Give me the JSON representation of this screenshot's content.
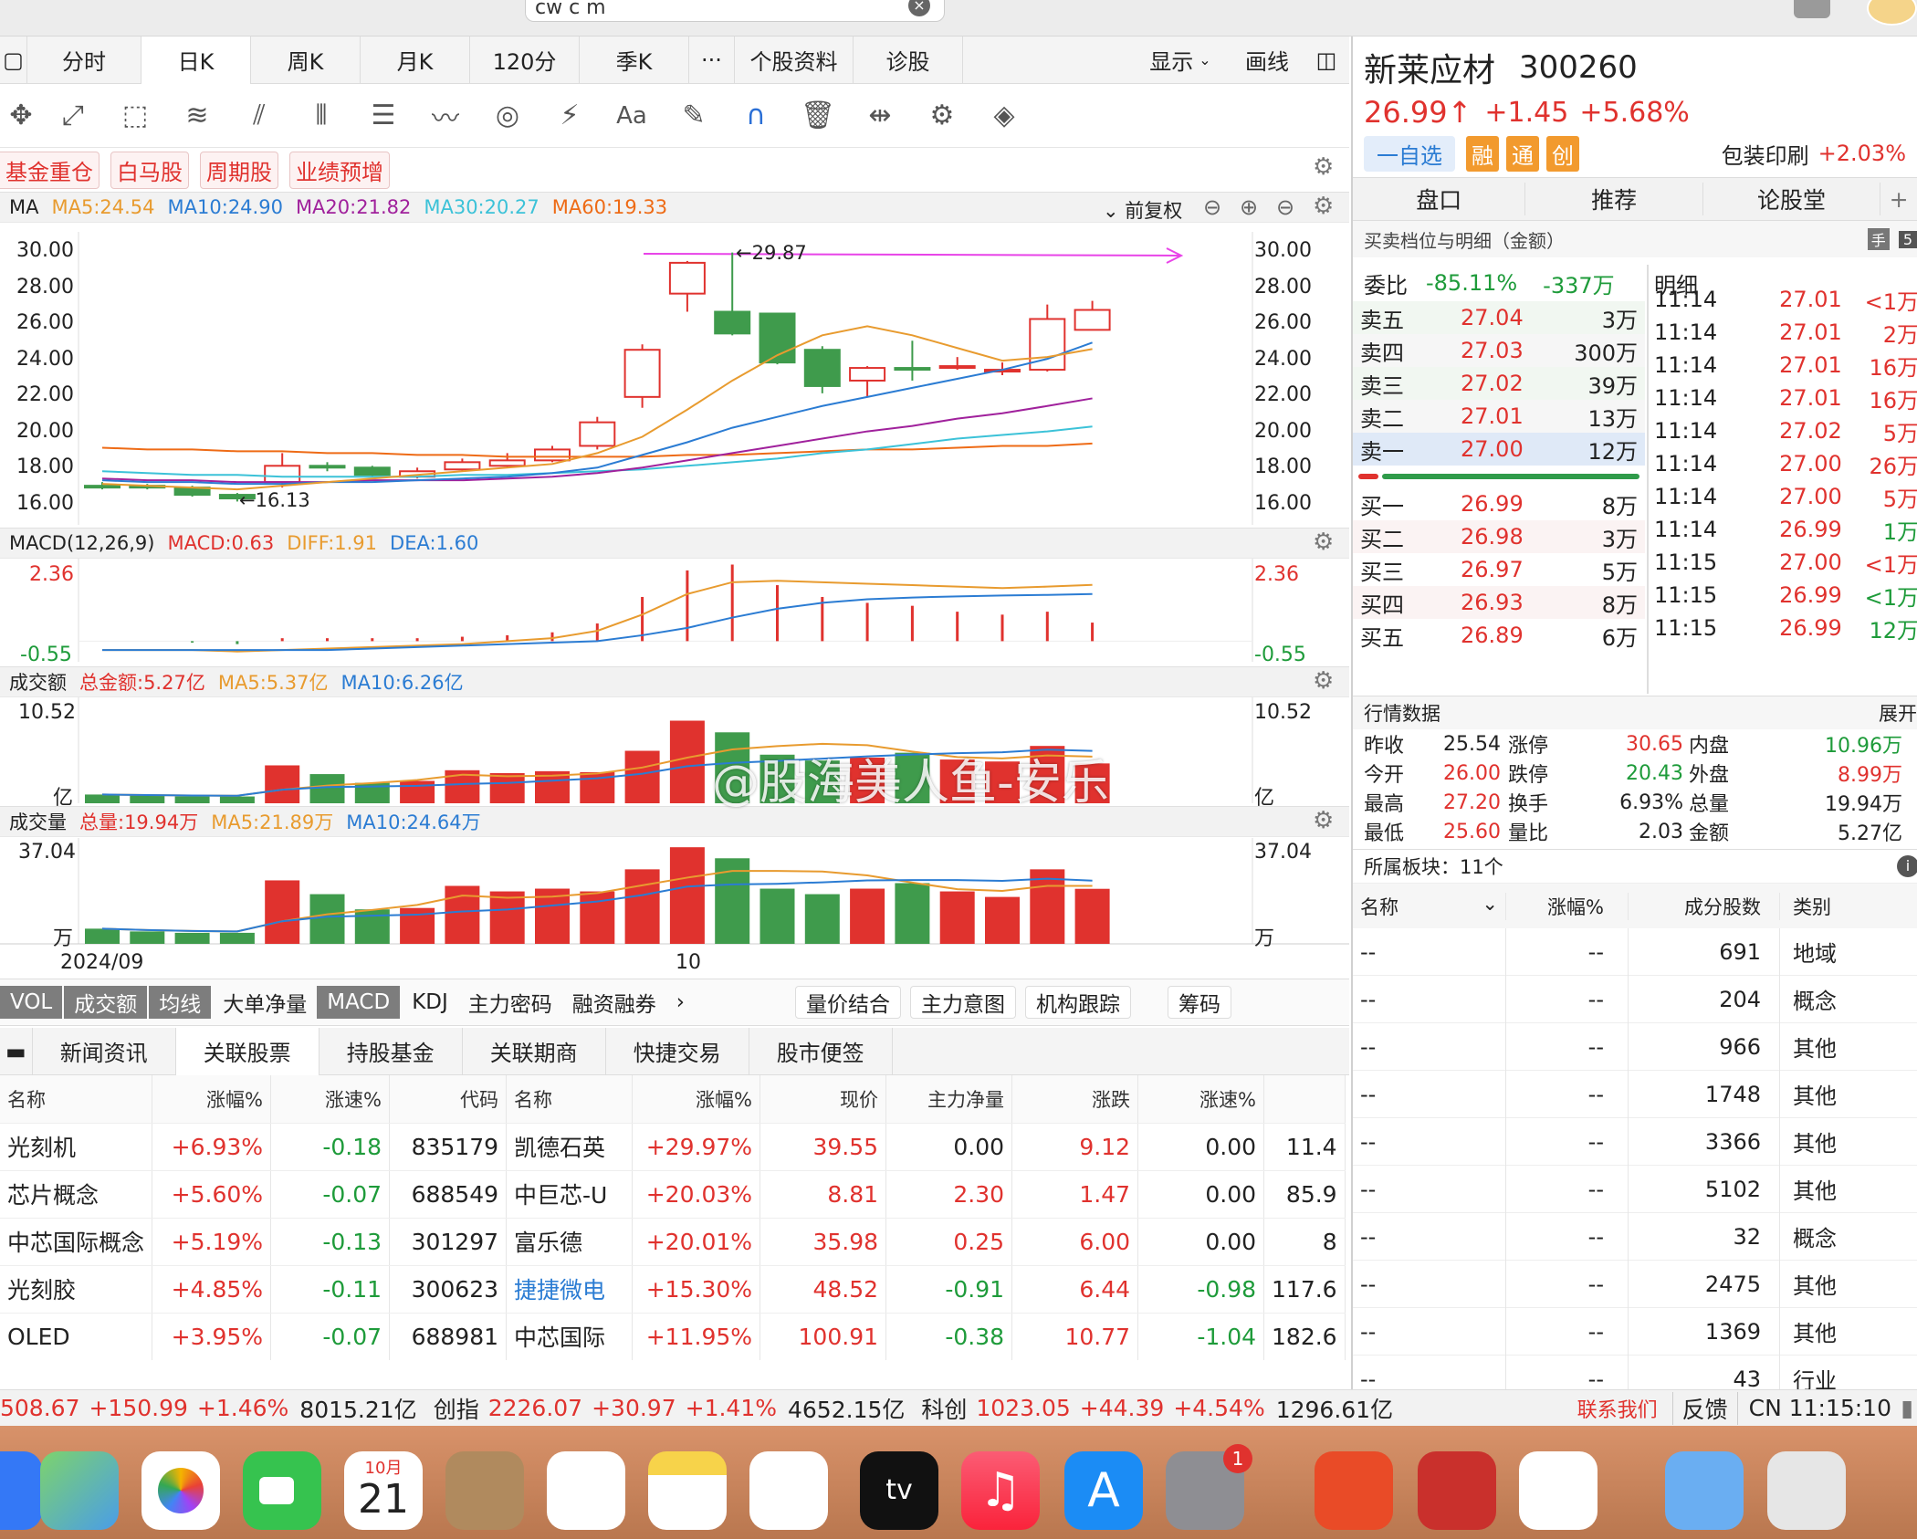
{
  "search": {
    "value": "cw c m"
  },
  "kline_tabs": [
    "分时",
    "日K",
    "周K",
    "月K",
    "120分",
    "季K",
    "···",
    "个股资料",
    "诊股"
  ],
  "toolbar_right": {
    "display": "显示",
    "draw": "画线"
  },
  "tags": [
    "基金重仓",
    "白马股",
    "周期股",
    "业绩预增"
  ],
  "ma_panel": {
    "label": "MA",
    "ma5": "MA5:24.54",
    "ma10": "MA10:24.90",
    "ma20": "MA20:21.82",
    "ma30": "MA30:20.27",
    "ma60": "MA60:19.33",
    "adjust": "前复权",
    "high_label": "←29.87",
    "low_label": "←16.13"
  },
  "price_axis": [
    "30.00",
    "28.00",
    "26.00",
    "24.00",
    "22.00",
    "20.00",
    "18.00",
    "16.00"
  ],
  "macd_panel": {
    "label": "MACD(12,26,9)",
    "macd": "MACD:0.63",
    "diff": "DIFF:1.91",
    "dea": "DEA:1.60",
    "top": "2.36",
    "bottom": "-0.55"
  },
  "amount_panel": {
    "label": "成交额",
    "total": "总金额:5.27亿",
    "ma5": "MA5:5.37亿",
    "ma10": "MA10:6.26亿",
    "top": "10.52",
    "unit": "亿"
  },
  "volume_panel": {
    "label": "成交量",
    "total": "总量:19.94万",
    "ma5": "MA5:21.89万",
    "ma10": "MA10:24.64万",
    "top": "37.04",
    "unit": "万"
  },
  "date_axis": {
    "start": "2024/09",
    "mid": "10"
  },
  "indicator_tabs": {
    "dark": [
      "VOL",
      "成交额",
      "均线"
    ],
    "plain": [
      "大单净量",
      "MACD",
      "KDJ",
      "主力密码",
      "融资融券",
      "›"
    ],
    "boxed": [
      "量价结合",
      "主力意图",
      "机构跟踪",
      "筹码"
    ]
  },
  "news_tabs": [
    "新闻资讯",
    "关联股票",
    "持股基金",
    "关联期商",
    "快捷交易",
    "股市便签"
  ],
  "rel_headers": [
    "名称",
    "涨幅%",
    "涨速%",
    "代码",
    "名称",
    "涨幅%",
    "现价",
    "主力净量",
    "涨跌",
    "涨速%",
    ""
  ],
  "rel_rows": [
    [
      "光刻机",
      "+6.93%",
      "-0.18",
      "835179",
      "凯德石英",
      "+29.97%",
      "39.55",
      "0.00",
      "9.12",
      "0.00",
      "11.4"
    ],
    [
      "芯片概念",
      "+5.60%",
      "-0.07",
      "688549",
      "中巨芯-U",
      "+20.03%",
      "8.81",
      "2.30",
      "1.47",
      "0.00",
      "85.9"
    ],
    [
      "中芯国际概念",
      "+5.19%",
      "-0.13",
      "301297",
      "富乐德",
      "+20.01%",
      "35.98",
      "0.25",
      "6.00",
      "0.00",
      "8"
    ],
    [
      "光刻胶",
      "+4.85%",
      "-0.11",
      "300623",
      "捷捷微电",
      "+15.30%",
      "48.52",
      "-0.91",
      "6.44",
      "-0.98",
      "117.6"
    ],
    [
      "OLED",
      "+3.95%",
      "-0.07",
      "688981",
      "中芯国际",
      "+11.95%",
      "100.91",
      "-0.38",
      "10.77",
      "-1.04",
      "182.6"
    ]
  ],
  "stock": {
    "name": "新莱应材",
    "code": "300260",
    "price": "26.99↑",
    "change": "+1.45",
    "pct": "+5.68%",
    "watch": "一自选",
    "badges": [
      "融",
      "通",
      "创"
    ],
    "sector": "包装印刷",
    "sector_pct": "+2.03%"
  },
  "right_tabs": [
    "盘口",
    "推荐",
    "论股堂",
    "+"
  ],
  "order_title": "买卖档位与明细（金额）",
  "weibi": {
    "label": "委比",
    "pct": "-85.11%",
    "amt": "-337万",
    "detail": "明细"
  },
  "asks": [
    [
      "卖五",
      "27.04",
      "3万"
    ],
    [
      "卖四",
      "27.03",
      "300万"
    ],
    [
      "卖三",
      "27.02",
      "39万"
    ],
    [
      "卖二",
      "27.01",
      "13万"
    ],
    [
      "卖一",
      "27.00",
      "12万"
    ]
  ],
  "bids": [
    [
      "买一",
      "26.99",
      "8万"
    ],
    [
      "买二",
      "26.98",
      "3万"
    ],
    [
      "买三",
      "26.97",
      "5万"
    ],
    [
      "买四",
      "26.93",
      "8万"
    ],
    [
      "买五",
      "26.89",
      "6万"
    ]
  ],
  "ticks": [
    [
      "11:14",
      "27.01",
      "<1万"
    ],
    [
      "11:14",
      "27.01",
      "2万"
    ],
    [
      "11:14",
      "27.01",
      "16万"
    ],
    [
      "11:14",
      "27.01",
      "16万"
    ],
    [
      "11:14",
      "27.02",
      "5万"
    ],
    [
      "11:14",
      "27.00",
      "26万"
    ],
    [
      "11:14",
      "27.00",
      "5万"
    ],
    [
      "11:14",
      "26.99",
      "1万"
    ],
    [
      "11:15",
      "27.00",
      "<1万"
    ],
    [
      "11:15",
      "26.99",
      "<1万"
    ],
    [
      "11:15",
      "26.99",
      "12万"
    ]
  ],
  "market": {
    "title": "行情数据",
    "expand": "展开",
    "rows": [
      [
        "昨收",
        "25.54",
        "涨停",
        "30.65",
        "内盘",
        "10.96万"
      ],
      [
        "今开",
        "26.00",
        "跌停",
        "20.43",
        "外盘",
        "8.99万"
      ],
      [
        "最高",
        "27.20",
        "换手",
        "6.93%",
        "总量",
        "19.94万"
      ],
      [
        "最低",
        "25.60",
        "量比",
        "2.03",
        "金额",
        "5.27亿"
      ]
    ]
  },
  "sectors": {
    "title": "所属板块：11个",
    "headers": [
      "名称",
      "涨幅%",
      "成分股数",
      "类别"
    ],
    "rows": [
      [
        "--",
        "--",
        "691",
        "地域"
      ],
      [
        "--",
        "--",
        "204",
        "概念"
      ],
      [
        "--",
        "--",
        "966",
        "其他"
      ],
      [
        "--",
        "--",
        "1748",
        "其他"
      ],
      [
        "--",
        "--",
        "3366",
        "其他"
      ],
      [
        "--",
        "--",
        "5102",
        "其他"
      ],
      [
        "--",
        "--",
        "32",
        "概念"
      ],
      [
        "--",
        "--",
        "2475",
        "其他"
      ],
      [
        "--",
        "--",
        "1369",
        "其他"
      ],
      [
        "--",
        "--",
        "43",
        "行业"
      ]
    ]
  },
  "ticker": {
    "idx1_val": "508.67",
    "idx1_chg": "+150.99",
    "idx1_pct": "+1.46%",
    "idx1_amt": "8015.21亿",
    "cy_name": "创指",
    "cy_val": "2226.07",
    "cy_chg": "+30.97",
    "cy_pct": "+1.41%",
    "cy_amt": "4652.15亿",
    "kc_name": "科创",
    "kc_val": "1023.05",
    "kc_chg": "+44.39",
    "kc_pct": "+4.54%",
    "kc_amt": "1296.61亿",
    "contact": "联系我们",
    "feedback": "反馈",
    "time": "CN 11:15:10"
  },
  "dock": {
    "calendar_month": "10月",
    "calendar_day": "21",
    "settings_badge": "1"
  },
  "watermark": "@股海美人鱼-安乐",
  "chart_data": {
    "type": "candlestick",
    "candles": [
      [
        17.0,
        16.9,
        17.2,
        16.8
      ],
      [
        17.0,
        16.9,
        17.1,
        16.8
      ],
      [
        16.9,
        16.5,
        17.0,
        16.4
      ],
      [
        16.5,
        16.3,
        16.6,
        16.13
      ],
      [
        17.2,
        18.1,
        18.8,
        16.9
      ],
      [
        18.1,
        18.0,
        18.3,
        17.8
      ],
      [
        18.0,
        17.6,
        18.1,
        17.5
      ],
      [
        17.5,
        17.8,
        18.0,
        17.4
      ],
      [
        17.9,
        18.3,
        18.5,
        17.8
      ],
      [
        18.1,
        18.4,
        18.8,
        18.0
      ],
      [
        18.4,
        19.0,
        19.2,
        18.3
      ],
      [
        19.2,
        20.5,
        20.8,
        19.0
      ],
      [
        21.9,
        24.5,
        24.8,
        21.3
      ],
      [
        27.6,
        29.3,
        29.4,
        26.6
      ],
      [
        26.6,
        25.4,
        29.87,
        25.3
      ],
      [
        26.5,
        23.8,
        26.5,
        23.7
      ],
      [
        24.5,
        22.5,
        24.7,
        22.1
      ],
      [
        22.8,
        23.5,
        23.6,
        21.9
      ],
      [
        23.5,
        23.4,
        25.0,
        22.8
      ],
      [
        23.5,
        23.6,
        24.1,
        23.4
      ],
      [
        23.3,
        23.4,
        23.8,
        23.1
      ],
      [
        23.4,
        26.2,
        27.0,
        23.3
      ],
      [
        25.6,
        26.7,
        27.2,
        25.6
      ]
    ],
    "ma5": [
      17.1,
      17.0,
      16.9,
      16.8,
      17.0,
      17.2,
      17.4,
      17.6,
      17.8,
      18.0,
      18.2,
      18.8,
      19.7,
      21.2,
      22.8,
      24.2,
      25.3,
      25.8,
      25.3,
      24.6,
      23.9,
      24.1,
      24.54
    ],
    "ma10": [
      17.3,
      17.2,
      17.2,
      17.1,
      17.1,
      17.2,
      17.2,
      17.3,
      17.4,
      17.5,
      17.7,
      18.0,
      18.7,
      19.4,
      20.2,
      20.8,
      21.4,
      21.9,
      22.4,
      22.9,
      23.4,
      24.0,
      24.9
    ],
    "ma20": [
      17.4,
      17.3,
      17.3,
      17.2,
      17.2,
      17.2,
      17.3,
      17.3,
      17.3,
      17.4,
      17.5,
      17.7,
      18.0,
      18.4,
      18.8,
      19.2,
      19.6,
      20.0,
      20.3,
      20.7,
      21.0,
      21.4,
      21.82
    ],
    "ma30": [
      17.8,
      17.7,
      17.6,
      17.6,
      17.5,
      17.5,
      17.5,
      17.5,
      17.6,
      17.6,
      17.7,
      17.8,
      17.9,
      18.1,
      18.3,
      18.5,
      18.8,
      19.0,
      19.3,
      19.6,
      19.8,
      20.0,
      20.27
    ],
    "ma60": [
      19.1,
      19.0,
      19.0,
      18.9,
      18.9,
      18.8,
      18.8,
      18.7,
      18.7,
      18.6,
      18.6,
      18.6,
      18.6,
      18.7,
      18.7,
      18.8,
      18.9,
      19.0,
      19.0,
      19.1,
      19.2,
      19.2,
      19.33
    ],
    "amount": [
      0.9,
      0.8,
      0.7,
      0.7,
      3.9,
      3.0,
      2.1,
      2.3,
      3.4,
      3.1,
      3.3,
      3.2,
      5.4,
      8.5,
      7.3,
      5.0,
      4.4,
      4.7,
      5.2,
      4.5,
      4.3,
      5.9,
      4.1
    ],
    "volume": [
      5.5,
      4.5,
      4.0,
      4.0,
      23.0,
      18.0,
      12.5,
      13.0,
      21.0,
      19.0,
      20.0,
      19.0,
      27.0,
      35.0,
      31.0,
      20.0,
      18.0,
      20.0,
      22.0,
      19.0,
      17.0,
      27.0,
      19.94
    ],
    "macd": [
      0.0,
      0.0,
      -0.05,
      -0.1,
      0.1,
      0.1,
      0.1,
      0.1,
      0.15,
      0.2,
      0.3,
      0.6,
      1.5,
      2.4,
      2.6,
      1.9,
      1.5,
      1.3,
      1.2,
      1.0,
      0.9,
      1.0,
      0.63
    ],
    "diff": [
      -0.3,
      -0.3,
      -0.3,
      -0.35,
      -0.3,
      -0.25,
      -0.2,
      -0.15,
      -0.1,
      0.0,
      0.1,
      0.35,
      0.9,
      1.6,
      2.0,
      2.05,
      2.0,
      1.95,
      1.9,
      1.85,
      1.8,
      1.85,
      1.91
    ],
    "dea": [
      -0.3,
      -0.3,
      -0.3,
      -0.3,
      -0.3,
      -0.3,
      -0.25,
      -0.2,
      -0.15,
      -0.1,
      -0.05,
      0.0,
      0.2,
      0.45,
      0.8,
      1.1,
      1.3,
      1.42,
      1.48,
      1.52,
      1.55,
      1.57,
      1.6
    ]
  }
}
